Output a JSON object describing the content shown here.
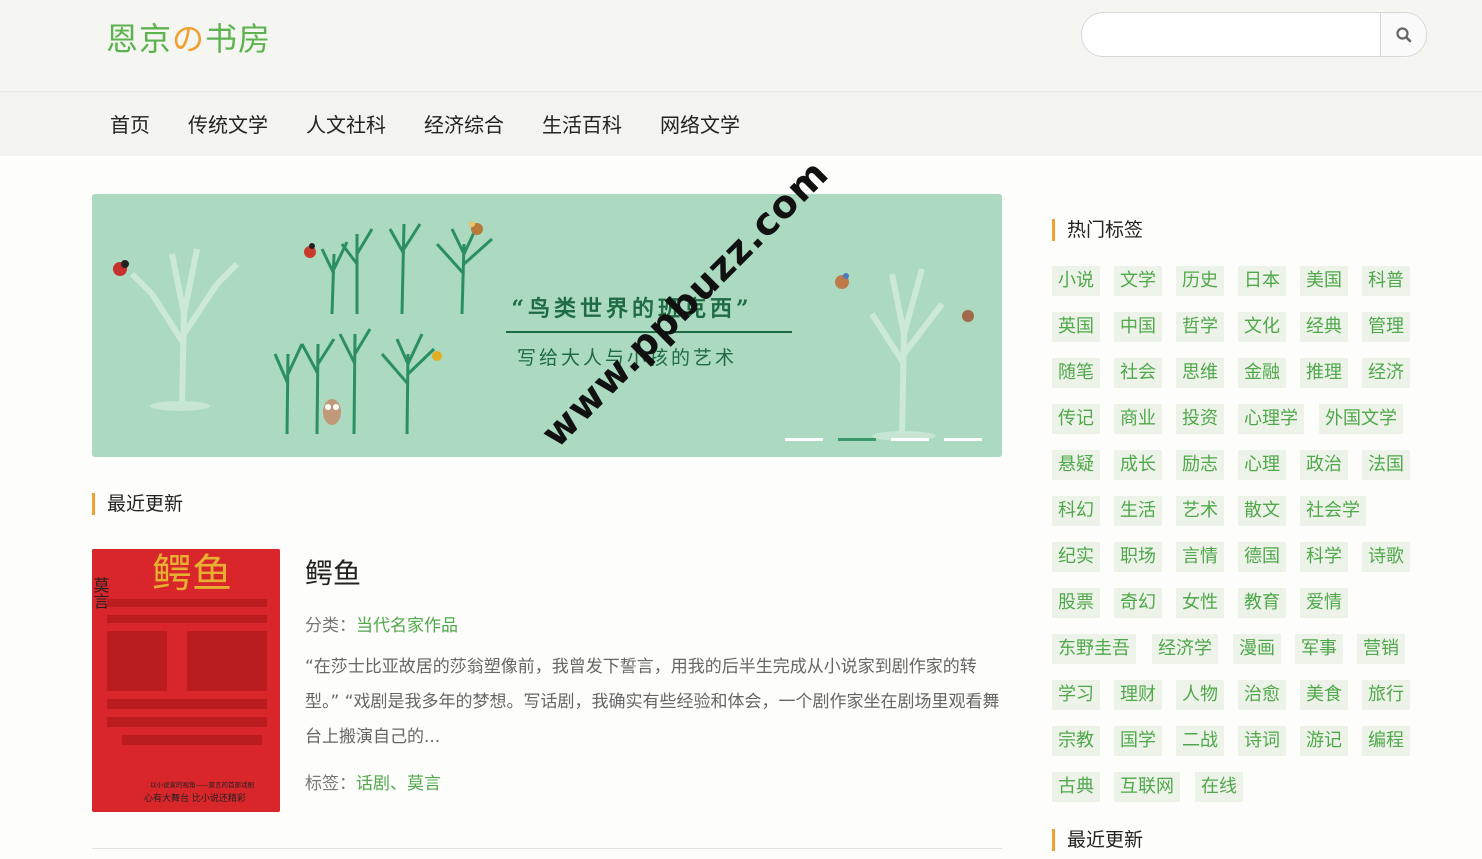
{
  "header": {
    "logo_part1": "恩京",
    "logo_part2": "の",
    "logo_part3": "书房",
    "search": {
      "placeholder": "",
      "icon": "search-icon"
    }
  },
  "nav": {
    "items": [
      "首页",
      "传统文学",
      "人文社科",
      "经济综合",
      "生活百科",
      "网络文学"
    ]
  },
  "banner": {
    "headline": "“鸟类世界的班克西”",
    "subline": "写给大人与小孩的艺术",
    "slide_count": 4,
    "active_slide": 2
  },
  "recent": {
    "section_title": "最近更新",
    "book": {
      "title": "鳄鱼",
      "category_label": "分类：",
      "category": "当代名家作品",
      "excerpt": "“在莎士比亚故居的莎翁塑像前，我曾发下誓言，用我的后半生完成从小说家到剧作家的转型。” “戏剧是我多年的梦想。写话剧，我确实有些经验和体会，一个剧作家坐在剧场里观看舞台上搬演自己的...",
      "tags_label": "标签：",
      "tags": "话剧、莫言",
      "cover_author": "莫言",
      "cover_title": "鳄鱼",
      "cover_caption_1": "以小说家的视角——莫言的首部话剧",
      "cover_caption_2": "心有大舞台 比小说还精彩"
    }
  },
  "sidebar": {
    "hot_tags_title": "热门标签",
    "tags": [
      [
        "小说",
        "文学",
        "历史",
        "日本",
        "美国",
        "科普"
      ],
      [
        "英国",
        "中国",
        "哲学",
        "文化",
        "经典",
        "管理"
      ],
      [
        "随笔",
        "社会",
        "思维",
        "金融",
        "推理",
        "经济"
      ],
      [
        "传记",
        "商业",
        "投资",
        "心理学",
        "外国文学"
      ],
      [
        "悬疑",
        "成长",
        "励志",
        "心理",
        "政治",
        "法国"
      ],
      [
        "科幻",
        "生活",
        "艺术",
        "散文",
        "社会学"
      ],
      [
        "纪实",
        "职场",
        "言情",
        "德国",
        "科学",
        "诗歌"
      ],
      [
        "股票",
        "奇幻",
        "女性",
        "教育",
        "爱情"
      ],
      [
        "东野圭吾",
        "经济学",
        "漫画",
        "军事",
        "营销"
      ],
      [
        "学习",
        "理财",
        "人物",
        "治愈",
        "美食",
        "旅行"
      ],
      [
        "宗教",
        "国学",
        "二战",
        "诗词",
        "游记",
        "编程"
      ],
      [
        "古典",
        "互联网",
        "在线"
      ]
    ],
    "recent_title": "最近更新"
  },
  "watermark": "www.ppbuzz.com"
}
